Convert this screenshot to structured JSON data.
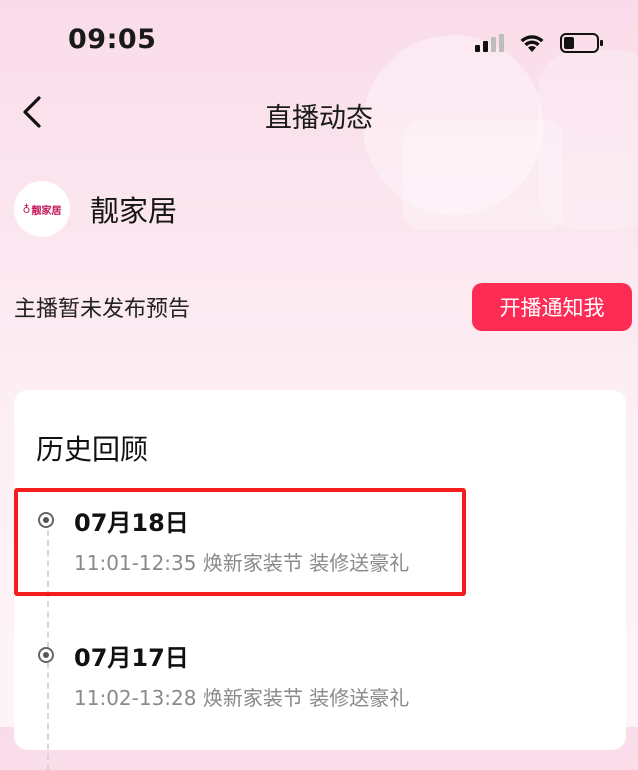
{
  "status_bar": {
    "time": "09:05",
    "icons": [
      "signal-icon",
      "wifi-icon",
      "battery-icon"
    ]
  },
  "nav": {
    "title": "直播动态",
    "back_icon": "chevron-left-icon"
  },
  "profile": {
    "avatar_text": "靓家居",
    "name": "靓家居"
  },
  "notice": {
    "text": "主播暂未发布预告",
    "button_label": "开播通知我"
  },
  "history": {
    "title": "历史回顾",
    "items": [
      {
        "date": "07月18日",
        "desc": "11:01-12:35 焕新家装节 装修送豪礼"
      },
      {
        "date": "07月17日",
        "desc": "11:02-13:28 焕新家装节 装修送豪礼"
      }
    ]
  },
  "colors": {
    "accent": "#fe2c55",
    "highlight": "#f21d1d",
    "background_top": "#f9dce9"
  }
}
